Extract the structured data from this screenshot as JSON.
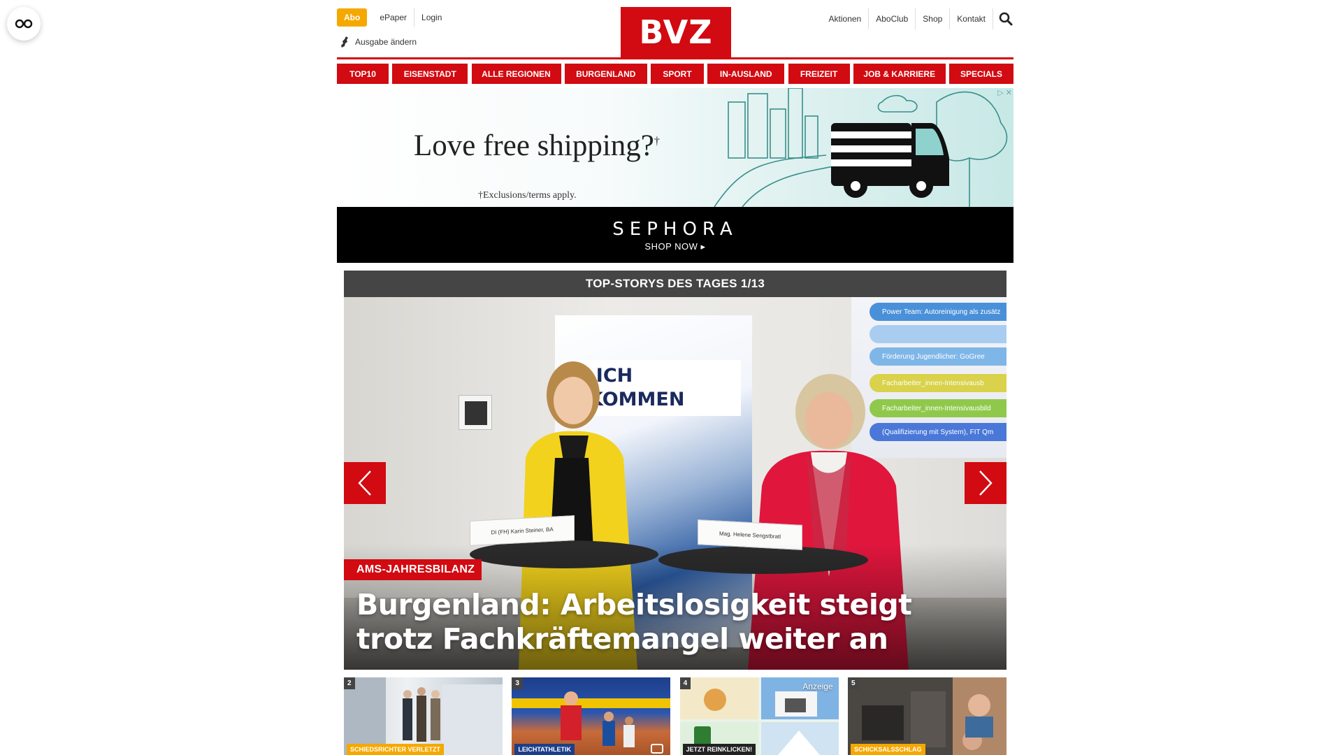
{
  "header": {
    "abo_label": "Abo",
    "epaper_label": "ePaper",
    "login_label": "Login",
    "edition_label": "Ausgabe ändern",
    "logo_text": "BVZ",
    "right_links": [
      "Aktionen",
      "AboClub",
      "Shop",
      "Kontakt"
    ]
  },
  "nav": {
    "items": [
      "TOP10",
      "EISENSTADT",
      "ALLE REGIONEN",
      "BURGENLAND",
      "SPORT",
      "IN-AUSLAND",
      "FREIZEIT",
      "JOB & KARRIERE",
      "SPECIALS"
    ]
  },
  "ad": {
    "headline": "Love free shipping?",
    "headline_mark": "†",
    "terms": "†Exclusions/terms apply.",
    "brand": "SEPHORA",
    "cta": "SHOP NOW ▸"
  },
  "stories": {
    "bar_title": "TOP-STORYS DES TAGES 1/13",
    "hero": {
      "kicker": "AMS-JAHRESBILANZ",
      "headline": "Burgenland: Arbeitslosigkeit steigt trotz Fachkräftemangel weiter an",
      "banner_text_1": "ZLICH",
      "banner_text_2": "KOMMEN",
      "projection_lines": [
        "Power Team: Autoreinigung als zusätz",
        "Förderung Jugendlicher: GoGree",
        "Facharbeiter_innen-Intensivausb",
        "Facharbeiter_innen-Intensivausbild",
        "(Qualifizierung mit System), FIT Qm"
      ],
      "name_card_1": "DI (FH) Karin Steiner, BA",
      "name_card_2": "Mag. Helene Sengstbratl"
    },
    "thumbs": [
      {
        "num": "2",
        "tag": "SCHIEDSRICHTER VERLETZT"
      },
      {
        "num": "3",
        "tag": "LEICHTATHLETIK"
      },
      {
        "num": "4",
        "tag": "JETZT REINKLICKEN!",
        "ad_label": "Anzeige"
      },
      {
        "num": "5",
        "tag": "SCHICKSALSSCHLAG"
      }
    ]
  },
  "colors": {
    "brand_red": "#d20a11",
    "abo_orange": "#f5a800",
    "bar_gray": "#454545"
  }
}
